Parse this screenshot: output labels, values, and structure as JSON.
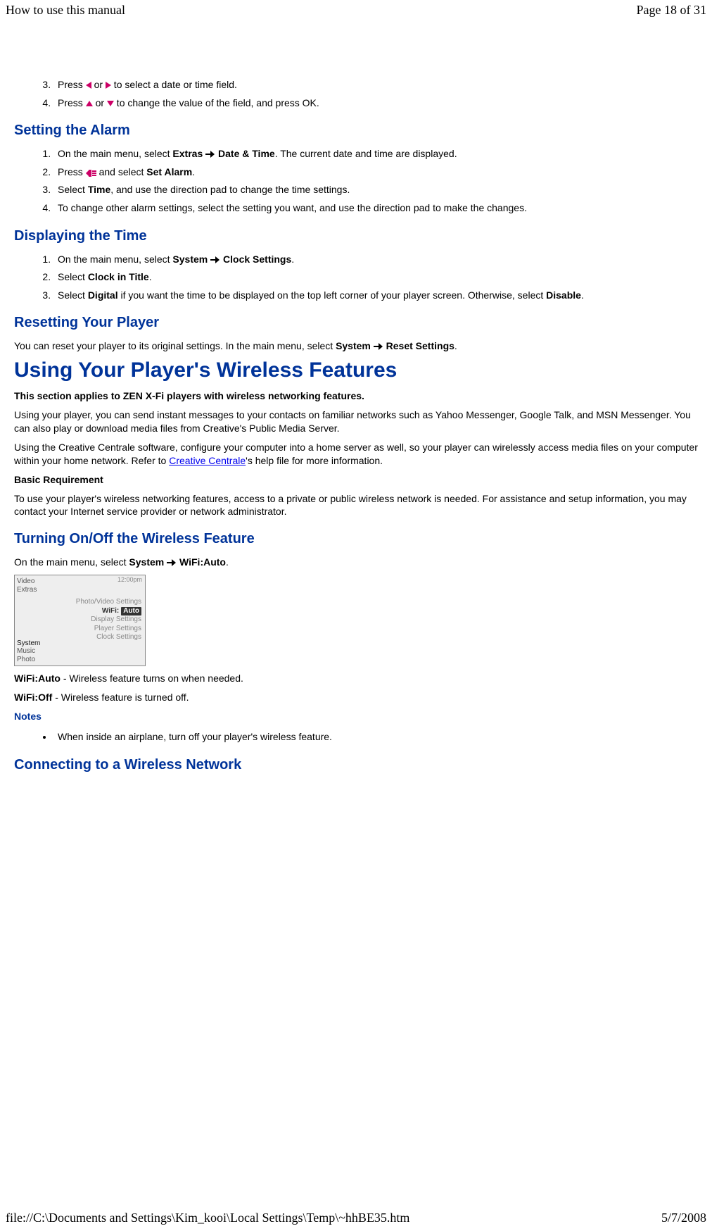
{
  "header": {
    "title": "How to use this manual",
    "page": "Page 18 of 31"
  },
  "footer": {
    "path": "file://C:\\Documents and Settings\\Kim_kooi\\Local Settings\\Temp\\~hhBE35.htm",
    "date": "5/7/2008"
  },
  "intro_steps": {
    "item3_pre": "Press ",
    "item3_mid": " or ",
    "item3_post": " to select a date or time field.",
    "item4_pre": "Press ",
    "item4_mid": " or ",
    "item4_post": " to change the value of the field, and press OK."
  },
  "alarm": {
    "heading": "Setting the Alarm",
    "s1_pre": "On the main menu, select ",
    "s1_b1": "Extras",
    "s1_mid": " ",
    "s1_b2": "Date & Time",
    "s1_post": ". The current date and time are displayed.",
    "s2_pre": "Press ",
    "s2_mid": " and select ",
    "s2_b": "Set Alarm",
    "s2_post": ".",
    "s3_pre": "Select ",
    "s3_b": "Time",
    "s3_post": ", and use the direction pad to change the time settings.",
    "s4": "To change other alarm settings, select the setting you want, and use the direction pad to make the changes."
  },
  "displaytime": {
    "heading": "Displaying the Time",
    "s1_pre": "On the main menu, select ",
    "s1_b1": "System",
    "s1_mid": " ",
    "s1_b2": "Clock Settings",
    "s1_post": ".",
    "s2_pre": "Select ",
    "s2_b": "Clock in Title",
    "s2_post": ".",
    "s3_pre": "Select ",
    "s3_b1": "Digital",
    "s3_mid": " if you want the time to be displayed on the top left corner of your player screen. Otherwise, select ",
    "s3_b2": "Disable",
    "s3_post": "."
  },
  "reset": {
    "heading": "Resetting Your Player",
    "p_pre": "You can reset your player to its original settings. In the main menu, select ",
    "p_b1": "System",
    "p_mid": " ",
    "p_b2": "Reset Settings",
    "p_post": "."
  },
  "wireless": {
    "h1": "Using Your Player's Wireless Features",
    "sub_bold": "This section applies to ZEN X-Fi players with wireless networking features.",
    "p1": "Using your player, you can send instant messages to your contacts on familiar networks such as Yahoo Messenger, Google Talk, and MSN Messenger. You can also play or download media files from Creative's Public Media Server.",
    "p2_pre": "Using the Creative Centrale software, configure your computer into a home server as well, so your player can wirelessly access media files on your computer within your home network. Refer to ",
    "p2_link": "Creative Centrale",
    "p2_post": "'s help file for more information.",
    "br_b": "Basic Requirement",
    "p3": "To use your player's wireless networking features, access to a private or public wireless network is needed. For assistance and setup information, you may contact your Internet service provider or network administrator."
  },
  "wifi": {
    "heading": "Turning On/Off the Wireless Feature",
    "p_pre": "On the main menu, select ",
    "p_b1": "System",
    "p_mid": " ",
    "p_b2": "WiFi:Auto",
    "p_post": ".",
    "auto_b": "WiFi:Auto",
    "auto_txt": " - Wireless feature turns on when needed.",
    "off_b": "WiFi:Off",
    "off_txt": " - Wireless feature is turned off.",
    "notes": "Notes",
    "note1": "When inside an airplane, turn off your player's wireless feature."
  },
  "connect": {
    "heading": "Connecting to a Wireless Network"
  },
  "screenshot": {
    "time": "12:00pm",
    "left_top1": "Video",
    "left_top2": "Extras",
    "left_bot1": "System",
    "left_bot2": "Music",
    "left_bot3": "Photo",
    "c1": "Photo/Video Settings",
    "c2a": "WiFi:",
    "c2b": "Auto",
    "c3": "Display Settings",
    "c4": "Player Settings",
    "c5": "Clock Settings"
  }
}
